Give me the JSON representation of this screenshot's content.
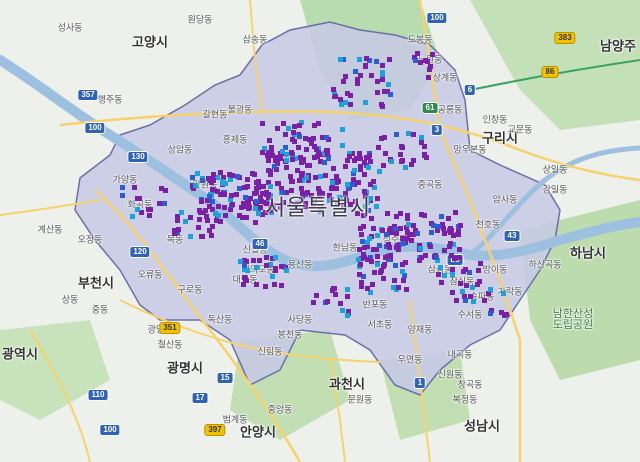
{
  "map": {
    "title": "서울특별시",
    "city_labels": [
      {
        "id": "goyang",
        "text": "고양시"
      },
      {
        "id": "namyangju",
        "text": "남양주"
      },
      {
        "id": "guri",
        "text": "구리시"
      },
      {
        "id": "hanam",
        "text": "하남시"
      },
      {
        "id": "bucheon",
        "text": "부천시"
      },
      {
        "id": "gwangmyeong",
        "text": "광명시"
      },
      {
        "id": "incheon",
        "text": "광역시"
      },
      {
        "id": "anyang",
        "text": "안양시"
      },
      {
        "id": "gwacheon",
        "text": "과천시"
      },
      {
        "id": "seongnam",
        "text": "성남시"
      }
    ],
    "district_labels": [
      {
        "id": "d1",
        "text": "성사동"
      },
      {
        "id": "d2",
        "text": "원당동"
      },
      {
        "id": "d3",
        "text": "행주동"
      },
      {
        "id": "d4",
        "text": "도봉동"
      },
      {
        "id": "d5",
        "text": "노원동"
      },
      {
        "id": "d6",
        "text": "상계동"
      },
      {
        "id": "d7",
        "text": "공릉동"
      },
      {
        "id": "d8",
        "text": "망우본동"
      },
      {
        "id": "d9",
        "text": "교문동"
      },
      {
        "id": "d10",
        "text": "인창동"
      },
      {
        "id": "d11",
        "text": "강일동"
      },
      {
        "id": "d12",
        "text": "상일동"
      },
      {
        "id": "d13",
        "text": "암사동"
      },
      {
        "id": "d14",
        "text": "천호동"
      },
      {
        "id": "d15",
        "text": "방이동"
      },
      {
        "id": "d16",
        "text": "잠실동"
      },
      {
        "id": "d17",
        "text": "송파동"
      },
      {
        "id": "d18",
        "text": "가락동"
      },
      {
        "id": "d19",
        "text": "수서동"
      },
      {
        "id": "d20",
        "text": "삼성동"
      },
      {
        "id": "d21",
        "text": "반포동"
      },
      {
        "id": "d22",
        "text": "서초동"
      },
      {
        "id": "d23",
        "text": "양재동"
      },
      {
        "id": "d24",
        "text": "우면동"
      },
      {
        "id": "d25",
        "text": "내곡동"
      },
      {
        "id": "d26",
        "text": "신원동"
      },
      {
        "id": "d27",
        "text": "사당동"
      },
      {
        "id": "d28",
        "text": "봉천동"
      },
      {
        "id": "d29",
        "text": "신림동"
      },
      {
        "id": "d30",
        "text": "독산동"
      },
      {
        "id": "d31",
        "text": "구로동"
      },
      {
        "id": "d32",
        "text": "오류동"
      },
      {
        "id": "d33",
        "text": "화곡동"
      },
      {
        "id": "d34",
        "text": "가양동"
      },
      {
        "id": "d35",
        "text": "목동"
      },
      {
        "id": "d36",
        "text": "대림동"
      },
      {
        "id": "d37",
        "text": "신길동"
      },
      {
        "id": "d38",
        "text": "여의도동"
      },
      {
        "id": "d39",
        "text": "용산동"
      },
      {
        "id": "d40",
        "text": "한남동"
      },
      {
        "id": "d41",
        "text": "성수동"
      },
      {
        "id": "d42",
        "text": "중곡동"
      },
      {
        "id": "d43",
        "text": "홍제동"
      },
      {
        "id": "d44",
        "text": "갈현동"
      },
      {
        "id": "d45",
        "text": "불광동"
      },
      {
        "id": "d46",
        "text": "상암동"
      },
      {
        "id": "d47",
        "text": "망원동"
      },
      {
        "id": "d48",
        "text": "삼송동"
      },
      {
        "id": "d49",
        "text": "문원동"
      },
      {
        "id": "d50",
        "text": "중앙동"
      },
      {
        "id": "d51",
        "text": "범계동"
      },
      {
        "id": "d52",
        "text": "복정동"
      },
      {
        "id": "d53",
        "text": "창곡동"
      },
      {
        "id": "d54",
        "text": "하산곡동"
      },
      {
        "id": "d55",
        "text": "광명동"
      },
      {
        "id": "d56",
        "text": "철산동"
      },
      {
        "id": "d57",
        "text": "중동"
      },
      {
        "id": "d58",
        "text": "상동"
      },
      {
        "id": "d59",
        "text": "오정동"
      },
      {
        "id": "d60",
        "text": "계산동"
      }
    ],
    "green_labels": [
      {
        "id": "g1",
        "text": "남한산성\n도립공원"
      }
    ],
    "road_shields": [
      {
        "id": "r100a",
        "text": "100",
        "style": "blue"
      },
      {
        "id": "r100b",
        "text": "100",
        "style": "blue"
      },
      {
        "id": "r100c",
        "text": "100",
        "style": "blue"
      },
      {
        "id": "r130",
        "text": "130",
        "style": "blue"
      },
      {
        "id": "r120",
        "text": "120",
        "style": "blue"
      },
      {
        "id": "r110",
        "text": "110",
        "style": "blue"
      },
      {
        "id": "r15",
        "text": "15",
        "style": "blue"
      },
      {
        "id": "r1",
        "text": "1",
        "style": "blue"
      },
      {
        "id": "r17",
        "text": "17",
        "style": "blue"
      },
      {
        "id": "r46",
        "text": "46",
        "style": "blue"
      },
      {
        "id": "r43",
        "text": "43",
        "style": "blue"
      },
      {
        "id": "r6",
        "text": "6",
        "style": "blue"
      },
      {
        "id": "r3",
        "text": "3",
        "style": "blue"
      },
      {
        "id": "r88",
        "text": "88",
        "style": "blue"
      },
      {
        "id": "r351",
        "text": "351",
        "style": "yellow"
      },
      {
        "id": "r397",
        "text": "397",
        "style": "yellow"
      },
      {
        "id": "r383",
        "text": "383",
        "style": "yellow"
      },
      {
        "id": "r86",
        "text": "86",
        "style": "yellow"
      },
      {
        "id": "r61",
        "text": "61",
        "style": "green"
      },
      {
        "id": "r357",
        "text": "357",
        "style": "blue"
      }
    ],
    "colors": {
      "seoul_fill": "#c7c9e6",
      "river": "#9dbfe0",
      "park": "#b9dbb0",
      "point_purple": "#7a1fa6",
      "point_cyan": "#1aa3d8",
      "point_blue": "#2a5fd1"
    }
  }
}
